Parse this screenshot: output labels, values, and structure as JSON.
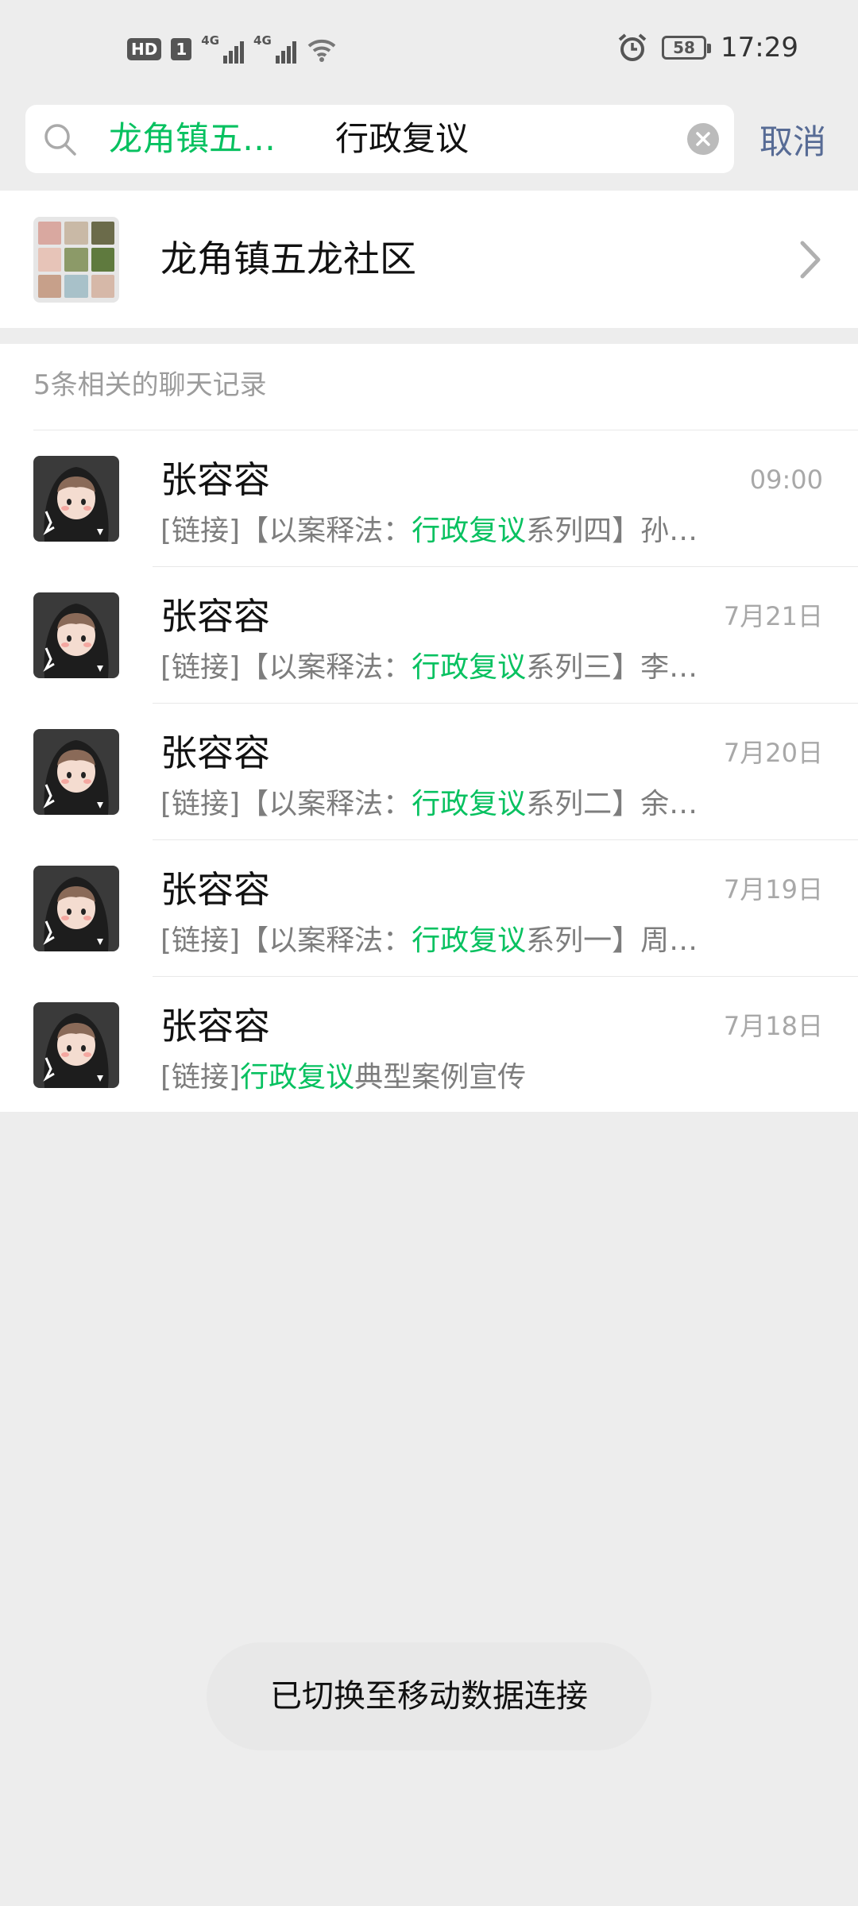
{
  "status_bar": {
    "hd": "HD",
    "sim": "1",
    "net1": "4G",
    "net2": "4G",
    "battery": "58",
    "time": "17:29"
  },
  "search": {
    "chat_tag": "龙角镇五…",
    "query": "行政复议",
    "cancel_label": "取消"
  },
  "group": {
    "name": "龙角镇五龙社区"
  },
  "results": {
    "header": "5条相关的聊天记录",
    "items": [
      {
        "name": "张容容",
        "time": "09:00",
        "prefix": "[链接]【以案释法：",
        "keyword": "行政复议",
        "suffix": "系列四】孙…"
      },
      {
        "name": "张容容",
        "time": "7月21日",
        "prefix": "[链接]【以案释法：",
        "keyword": "行政复议",
        "suffix": "系列三】李…"
      },
      {
        "name": "张容容",
        "time": "7月20日",
        "prefix": "[链接]【以案释法：",
        "keyword": "行政复议",
        "suffix": "系列二】余…"
      },
      {
        "name": "张容容",
        "time": "7月19日",
        "prefix": "[链接]【以案释法：",
        "keyword": "行政复议",
        "suffix": "系列一】周…"
      },
      {
        "name": "张容容",
        "time": "7月18日",
        "prefix": "[链接]",
        "keyword": "行政复议",
        "suffix": "典型案例宣传"
      }
    ]
  },
  "toast": "已切换至移动数据连接",
  "colors": {
    "highlight": "#07c160",
    "cancel": "#576b95",
    "background": "#ededed"
  }
}
